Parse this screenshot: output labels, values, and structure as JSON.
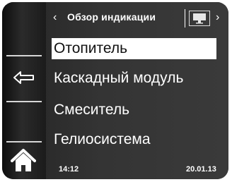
{
  "header": {
    "back_arrow": "‹",
    "forward_arrow": "›",
    "title": "Обзор индикации"
  },
  "menu": {
    "items": [
      {
        "label": "Отопитель",
        "selected": true
      },
      {
        "label": "Каскадный модуль",
        "selected": false
      },
      {
        "label": "Смеситель",
        "selected": false
      },
      {
        "label": "Гелиосистема",
        "selected": false
      }
    ]
  },
  "sidebar": {
    "back_icon": "back-arrow-icon",
    "home_icon": "home-icon"
  },
  "status": {
    "time": "14:12",
    "date": "20.01.13"
  },
  "colors": {
    "panel_bg": "#2a2a2a",
    "selected_bg": "#ffffff",
    "text": "#ffffff"
  }
}
